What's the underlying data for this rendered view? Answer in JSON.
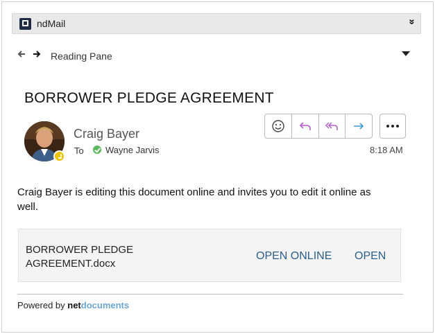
{
  "app": {
    "name": "ndMail",
    "logo_icon": "nd-logo-icon",
    "collapse_glyph": "»"
  },
  "nav": {
    "back_glyph": "🡐",
    "forward_glyph": "🡒",
    "pane_label": "Reading Pane"
  },
  "message": {
    "subject": "BORROWER PLEDGE AGREEMENT",
    "sender": "Craig Bayer",
    "to_label": "To",
    "recipient": "Wayne Jarvis",
    "time": "8:18 AM",
    "body": "Craig Bayer is editing this document online and invites you to edit it online as well."
  },
  "attachment": {
    "file_name": "BORROWER PLEDGE AGREEMENT.docx",
    "open_online_label": "OPEN ONLINE",
    "open_label": "OPEN"
  },
  "footer": {
    "powered_by": "Powered by ",
    "brand_net": "net",
    "brand_docs": "documents"
  },
  "colors": {
    "accent_link": "#2a5f8f",
    "reply_icon": "#b85bd0",
    "forward_icon": "#3a9ad9",
    "presence_away": "#f2c200",
    "recipient_online": "#5cb85c"
  }
}
